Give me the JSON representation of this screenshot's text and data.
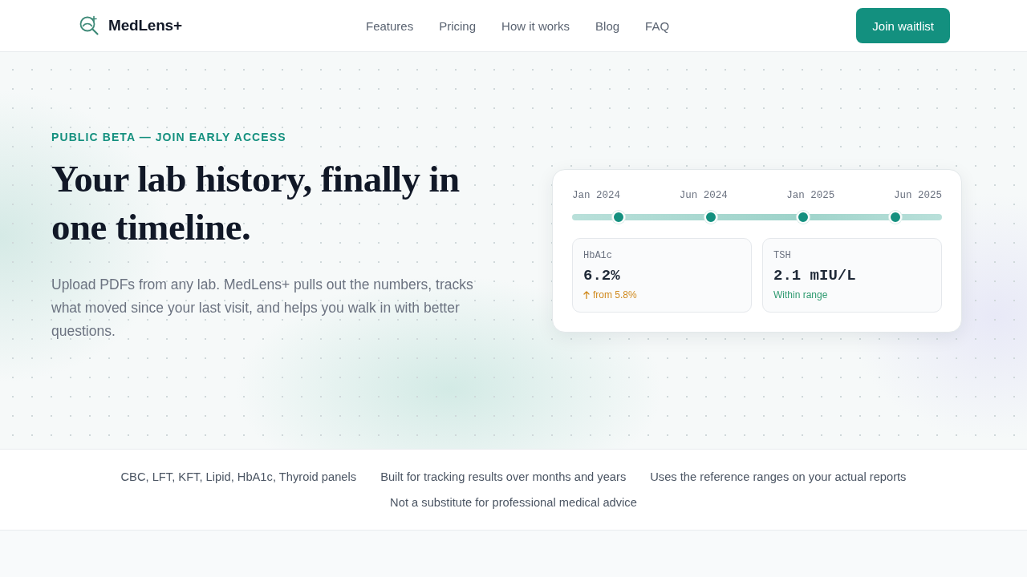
{
  "nav": {
    "brand": "MedLens+",
    "links": [
      "Features",
      "Pricing",
      "How it works",
      "Blog",
      "FAQ"
    ],
    "cta": "Join waitlist"
  },
  "hero": {
    "eyebrow": "PUBLIC BETA — JOIN EARLY ACCESS",
    "headline": "Your lab history, finally in one timeline.",
    "description": "Upload PDFs from any lab. MedLens+ pulls out the numbers, tracks what moved since your last visit, and helps you walk in with better questions."
  },
  "timeline_card": {
    "dates": [
      "Jan 2024",
      "Jun 2024",
      "Jan 2025",
      "Jun 2025"
    ],
    "metrics": [
      {
        "name": "HbA1c",
        "value": "6.2%",
        "note": "from 5.8%",
        "kind": "increase"
      },
      {
        "name": "TSH",
        "value": "2.1 mIU/L",
        "note": "Within range",
        "kind": "normal"
      }
    ]
  },
  "highlights": [
    "CBC, LFT, KFT, Lipid, HbA1c, Thyroid panels",
    "Built for tracking results over months and years",
    "Uses the reference ranges on your actual reports",
    "Not a substitute for professional medical advice"
  ]
}
